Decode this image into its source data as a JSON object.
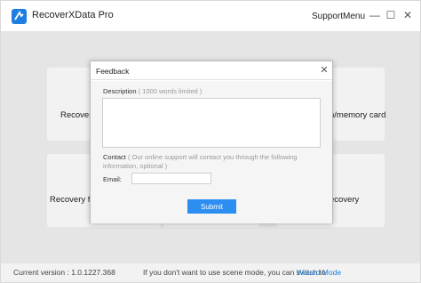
{
  "app": {
    "title": "RecoverXData Pro",
    "brand_color": "#1f7fe0",
    "logo_icon": "recoverxdata-logo-icon"
  },
  "titlebar": {
    "support_label": "Support",
    "menu_label": "Menu",
    "minimize_glyph": "—",
    "maximize_glyph": "☐",
    "close_glyph": "✕"
  },
  "cards": [
    {
      "label": "Recovery"
    },
    {
      "label": "h/memory card"
    },
    {
      "label": "Recovery for"
    },
    {
      "label": "ecovery"
    }
  ],
  "status": {
    "version": "Current version : 1.0.1227.368",
    "switch_text": "If you don't want to use scene mode, you can switch to",
    "wizard_link": "Wizard Mode"
  },
  "dialog": {
    "title": "Feedback",
    "close_glyph": "✕",
    "description_label": "Description",
    "description_limit": " ( 1000 words limited )",
    "description_value": "",
    "contact_label": "Contact",
    "contact_note": " ( Our online support will contact you through the following information, optional )",
    "email_label": "Email:",
    "email_value": "",
    "submit_label": "Submit",
    "accent_color": "#2b8ef0"
  }
}
